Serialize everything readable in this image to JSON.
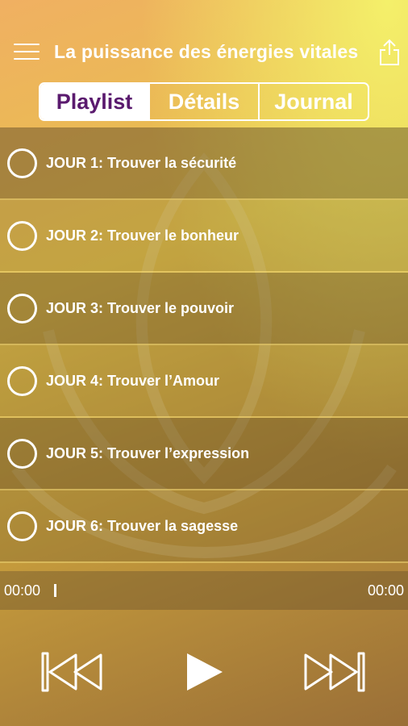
{
  "header": {
    "title": "La puissance des énergies vitales",
    "menu_icon": "hamburger-menu-icon",
    "share_icon": "share-icon"
  },
  "tabs": [
    {
      "label": "Playlist",
      "active": true
    },
    {
      "label": "Détails",
      "active": false
    },
    {
      "label": "Journal",
      "active": false
    }
  ],
  "playlist": [
    {
      "label": "JOUR 1: Trouver la sécurité"
    },
    {
      "label": "JOUR 2: Trouver le bonheur"
    },
    {
      "label": "JOUR 3: Trouver le pouvoir"
    },
    {
      "label": "JOUR 4: Trouver l’Amour"
    },
    {
      "label": "JOUR 5: Trouver l’expression"
    },
    {
      "label": "JOUR 6: Trouver la sagesse"
    }
  ],
  "player": {
    "elapsed": "00:00",
    "duration": "00:00",
    "progress": 0,
    "icons": [
      "skip-previous-icon",
      "play-icon",
      "skip-next-icon"
    ]
  },
  "colors": {
    "accent_tab_text": "#5a1a6e",
    "text": "#ffffff"
  }
}
